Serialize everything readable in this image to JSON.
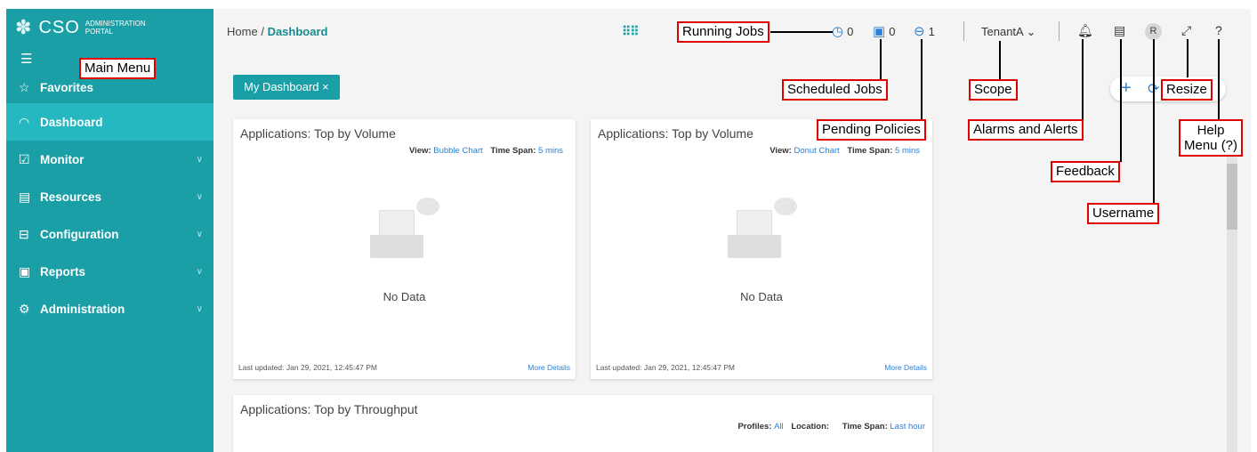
{
  "sidebar": {
    "brand_title": "CSO",
    "brand_subtitle": "ADMINISTRATION PORTAL",
    "items": [
      {
        "label": "Favorites",
        "icon": "star-icon"
      },
      {
        "label": "Dashboard",
        "icon": "dashboard-icon",
        "active": true
      },
      {
        "label": "Monitor",
        "icon": "monitor-icon"
      },
      {
        "label": "Resources",
        "icon": "resources-icon"
      },
      {
        "label": "Configuration",
        "icon": "configuration-icon"
      },
      {
        "label": "Reports",
        "icon": "reports-icon"
      },
      {
        "label": "Administration",
        "icon": "administration-icon"
      }
    ]
  },
  "header": {
    "breadcrumb_home": "Home",
    "breadcrumb_sep": "/",
    "breadcrumb_current": "Dashboard",
    "running_jobs_count": "0",
    "scheduled_jobs_count": "0",
    "pending_policies_count": "1",
    "tenant": "TenantA",
    "avatar_initial": "R",
    "help": "?"
  },
  "dashboard_tab": {
    "label": "My Dashboard",
    "close": "×"
  },
  "cards": [
    {
      "title": "Applications: Top by Volume",
      "view_label": "View:",
      "view_value": "Bubble Chart",
      "span_label": "Time Span:",
      "span_value": "5 mins",
      "empty": "No Data",
      "updated": "Last updated: Jan 29, 2021, 12:45:47 PM",
      "more": "More Details"
    },
    {
      "title": "Applications: Top by Volume",
      "view_label": "View:",
      "view_value": "Donut Chart",
      "span_label": "Time Span:",
      "span_value": "5 mins",
      "empty": "No Data",
      "updated": "Last updated: Jan 29, 2021, 12:45:47 PM",
      "more": "More Details"
    },
    {
      "title": "Applications: Top by Throughput",
      "profiles_label": "Profiles:",
      "profiles_value": "All",
      "location_label": "Location:",
      "span_label": "Time Span:",
      "span_value": "Last hour"
    }
  ],
  "annotations": {
    "main_menu": "Main Menu",
    "running_jobs": "Running Jobs",
    "scheduled_jobs": "Scheduled Jobs",
    "pending_policies": "Pending Policies",
    "scope": "Scope",
    "alarms": "Alarms and Alerts",
    "feedback": "Feedback",
    "username": "Username",
    "resize": "Resize",
    "help_line1": "Help",
    "help_line2": "Menu (?)"
  },
  "colors": {
    "sidebar": "#1a9fa6",
    "active": "#25b8c0",
    "link": "#2a7fd6",
    "annotation": "#e00000"
  }
}
